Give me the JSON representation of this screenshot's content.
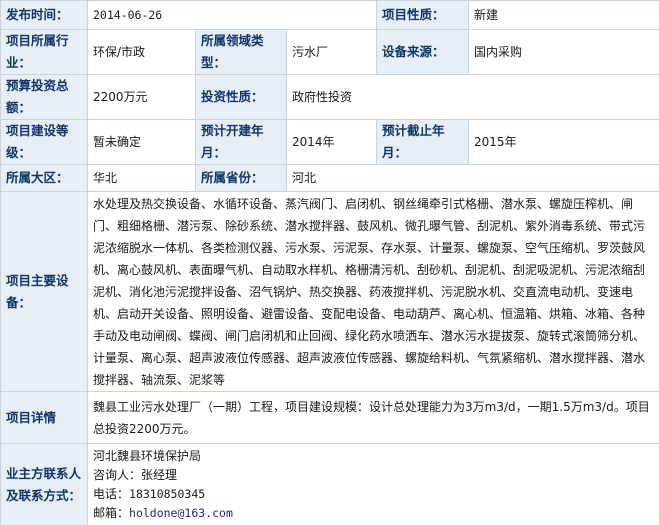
{
  "fields": {
    "publish_time": {
      "label": "发布时间：",
      "value": "2014-06-26"
    },
    "project_nature": {
      "label": "项目性质：",
      "value": "新建"
    },
    "industry": {
      "label": "项目所属行业：",
      "value": "环保/市政"
    },
    "domain_type": {
      "label": "所属领域类型：",
      "value": "污水厂"
    },
    "equipment_source": {
      "label": "设备来源：",
      "value": "国内采购"
    },
    "budget": {
      "label": "预算投资总额：",
      "value": "2200万元"
    },
    "investment_nature": {
      "label": "投资性质：",
      "value": "政府性投资"
    },
    "construction_grade": {
      "label": "项目建设等级：",
      "value": "暂未确定"
    },
    "planned_start": {
      "label": "预计开建年月：",
      "value": "2014年"
    },
    "planned_end": {
      "label": "预计截止年月：",
      "value": "2015年"
    },
    "region": {
      "label": "所属大区：",
      "value": "华北"
    },
    "province": {
      "label": "所属省份：",
      "value": "河北"
    },
    "main_equipment": {
      "label": "项目主要设备：",
      "value": "水处理及热交换设备、水循环设备、蒸汽阀门、启闭机、钢丝绳牵引式格栅、潜水泵、螺旋压榨机、闸门、粗细格栅、潜污泵、除砂系统、潜水搅拌器、鼓风机、微孔曝气管、刮泥机、紫外消毒系统、带式污泥浓缩脱水一体机、各类检测仪器、污水泵、污泥泵、存水泵、计量泵、螺旋泵、空气压缩机、罗茨鼓风机、离心鼓风机、表面曝气机、自动取水样机、格栅清污机、刮砂机、刮泥机、刮泥吸泥机、污泥浓缩刮泥机、消化池污泥搅拌设备、沼气锅炉、热交换器、药液搅拌机、污泥脱水机、交直流电动机、变速电机、启动开关设备、照明设备、避雷设备、变配电设备、电动葫芦、离心机、恒温箱、烘箱、冰箱、各种手动及电动闸阀、蝶阀、闸门启闭机和止回阀、绿化药水喷洒车、潜水污水提拔泵、旋转式滚筒筛分机、计量泵、离心泵、超声波液位传感器、超声波液位传感器、螺旋给料机、气氛紧缩机、潜水搅拌器、潜水搅拌器、轴流泵、泥浆等"
    },
    "details": {
      "label": "项目详情",
      "value": "魏县工业污水处理厂（一期）工程，项目建设规模：设计总处理能力为3万m3/d，一期1.5万m3/d。项目总投资2200万元。"
    },
    "contact": {
      "label": "业主方联系人及联系方式：",
      "org": "河北魏县环境保护局",
      "consultant": "咨询人：张经理",
      "phone_label": "电话：",
      "phone": "18310850345",
      "email_label": "邮箱：",
      "email": "holdone@163.com"
    }
  }
}
